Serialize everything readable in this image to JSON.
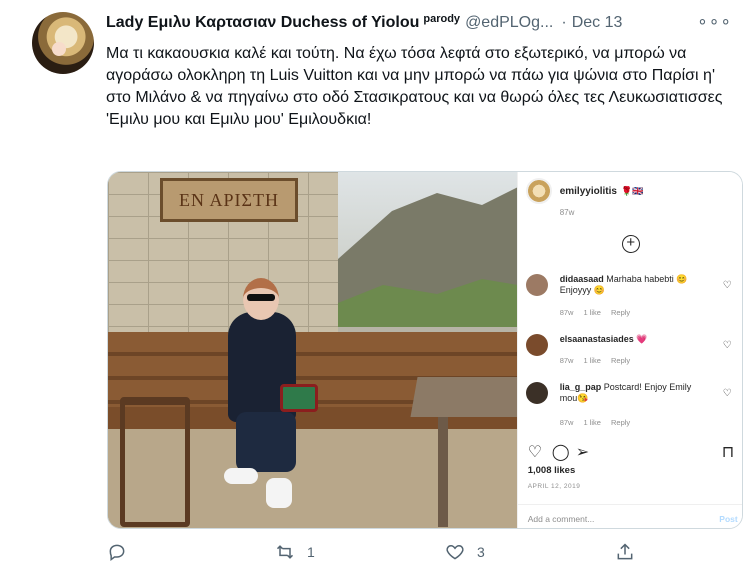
{
  "tweet": {
    "author_name": "Lady Εμιλυ Καρτασιαν Duchess of Yiolou",
    "parody_label": "parody",
    "handle": "@edPLOg...",
    "separator": "·",
    "date": "Dec 13",
    "more_label": "∘∘∘",
    "text": "Μα τι κακαουσκια καλέ και τούτη.  Να έχω τόσα λεφτά στο εξωτερικό, να μπορώ να αγοράσω ολοκληρη τη Luis Vuitton και να μην μπορώ να πάω για ψώνια στο Παρίσι η' στο Μιλάνο & να πηγαίνω στο οδό Στασικρατους και να θωρώ όλες τες Λευκωσιατισσες 'Εμιλυ μου και Εμιλυ μου' Εμιλουδκια!"
  },
  "photo": {
    "sign_text": "ΕΝ ΑΡΙΣΤΗ"
  },
  "instagram": {
    "username": "emilyyiolitis",
    "flags": "🌹🇬🇧",
    "post_time": "87w",
    "comments": [
      {
        "user": "didaasaad",
        "text": "Marhaba habebti 😊 Enjoyyy 😊",
        "time": "87w",
        "likes": "1 like",
        "reply": "Reply",
        "avatar_color": "#9c7a64"
      },
      {
        "user": "elsaanastasiades",
        "text": "💗",
        "time": "87w",
        "likes": "1 like",
        "reply": "Reply",
        "avatar_color": "#7a4b2c"
      },
      {
        "user": "lia_g_pap",
        "text": "Postcard! Enjoy Emily mou😘",
        "time": "87w",
        "likes": "1 like",
        "reply": "Reply",
        "avatar_color": "#3b3027"
      }
    ],
    "likes": "1,008 likes",
    "date": "APRIL 12, 2019",
    "add_comment_placeholder": "Add a comment...",
    "post_label": "Post"
  },
  "actions": {
    "reply_count": "",
    "retweet_count": "1",
    "like_count": "3"
  },
  "colors": {
    "text_primary": "#0f1419",
    "text_secondary": "#536471",
    "border": "#cfd9de"
  }
}
